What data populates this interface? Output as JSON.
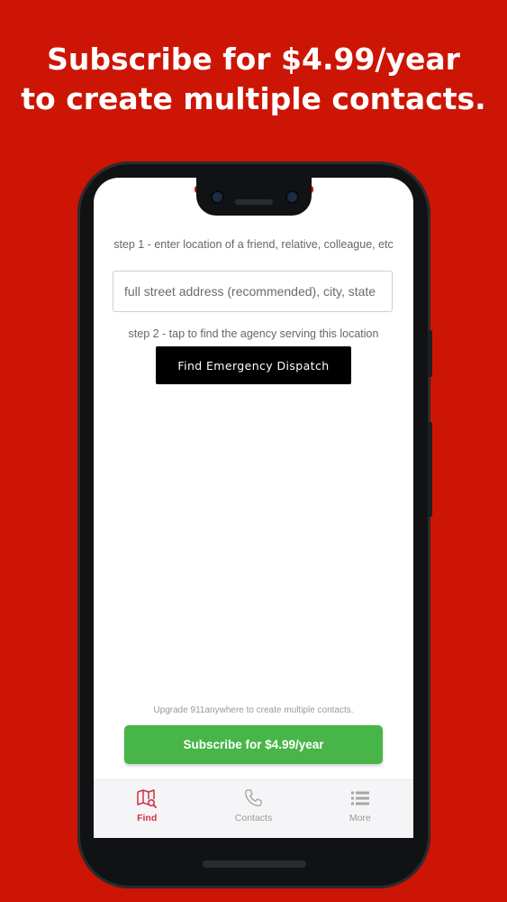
{
  "headline": {
    "line1": "Subscribe for $4.99/year",
    "line2": "to create multiple contacts."
  },
  "form": {
    "step1_text": "step 1 - enter location of a friend, relative, colleague, etc",
    "address_placeholder": "full street address (recommended), city, state",
    "address_value": "",
    "step2_text": "step 2 - tap to find the agency serving this location",
    "find_button_label": "Find Emergency Dispatch"
  },
  "upgrade": {
    "note": "Upgrade 911anywhere to create multiple contacts.",
    "subscribe_button_label": "Subscribe for $4.99/year"
  },
  "tabs": [
    {
      "label": "Find",
      "icon": "map-search-icon",
      "active": true
    },
    {
      "label": "Contacts",
      "icon": "phone-icon",
      "active": false
    },
    {
      "label": "More",
      "icon": "list-icon",
      "active": false
    }
  ],
  "colors": {
    "background": "#cc1505",
    "subscribe_button": "#47b548",
    "active_tab": "#d42f44",
    "find_button": "#000000"
  }
}
